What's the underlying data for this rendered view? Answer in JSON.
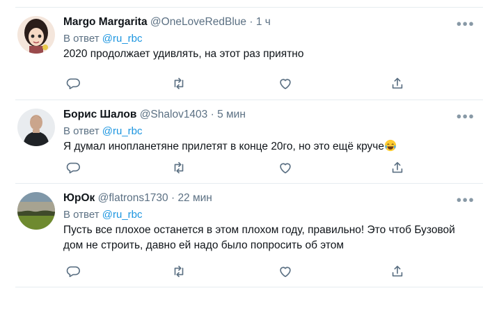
{
  "tweets": [
    {
      "name": "Margo Margarita",
      "handle": "@OneLoveRedBlue",
      "separator": "·",
      "time": "1 ч",
      "reply_prefix": "В ответ",
      "reply_to": "@ru_rbc",
      "text": "2020 продолжает удивлять, на этот раз приятно",
      "more_icon": "more-icon"
    },
    {
      "name": "Борис Шалов",
      "handle": "@Shalov1403",
      "separator": "·",
      "time": "5 мин",
      "reply_prefix": "В ответ",
      "reply_to": "@ru_rbc",
      "text": "Я думал инопланетяне прилетят в конце 20го, но это ещё круче",
      "emoji": "tears-of-joy-emoji"
    },
    {
      "name": "ЮрОк",
      "handle": "@flatrons1730",
      "separator": "·",
      "time": "22 мин",
      "reply_prefix": "В ответ",
      "reply_to": "@ru_rbc",
      "text": "Пусть все плохое останется в этом плохом году, правильно! Это чтоб Бузовой дом не строить, давно ей надо было попросить об этом"
    }
  ],
  "colors": {
    "link": "#1b95e0",
    "secondary_text": "#5b7083",
    "icon": "#5b7083",
    "divider": "#e6ecf0"
  }
}
